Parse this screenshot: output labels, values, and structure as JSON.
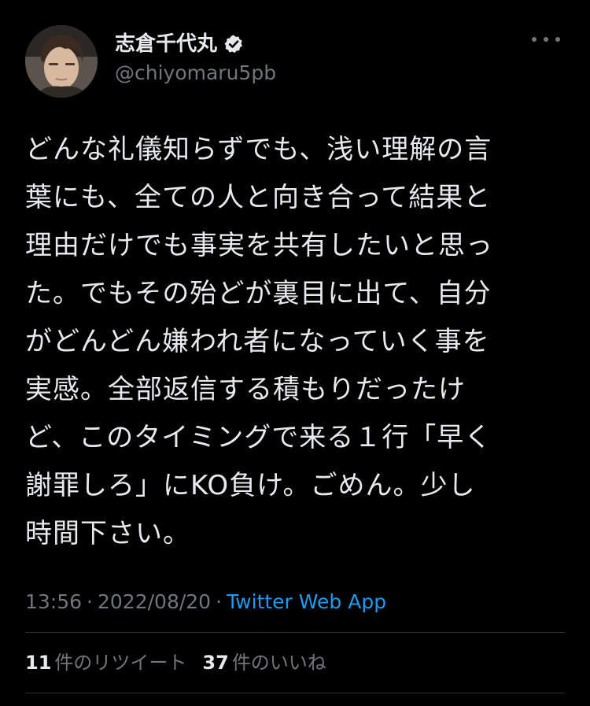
{
  "author": {
    "display_name": "志倉千代丸",
    "handle": "@chiyomaru5pb",
    "avatar_icon": "avatar-photo",
    "verified_icon": "verified-badge-icon",
    "more_icon": "more-options-icon"
  },
  "tweet": {
    "lines": [
      "どんな礼儀知らずでも、浅い理解の言",
      "葉にも、全ての人と向き合って結果と",
      "理由だけでも事実を共有したいと思っ",
      "た。でもその殆どが裏目に出て、自分",
      "がどんどん嫌われ者になっていく事を",
      "実感。全部返信する積もりだったけ",
      "ど、このタイミングで来る１行「早く",
      "謝罪しろ」にKO負け。ごめん。少し",
      "時間下さい。"
    ]
  },
  "meta": {
    "time": "13:56",
    "separator": "·",
    "date": "2022/08/20",
    "source": "Twitter Web App"
  },
  "stats": {
    "retweets_count": "11",
    "retweets_label": "件のリツイート",
    "likes_count": "37",
    "likes_label": "件のいいね"
  },
  "colors": {
    "background": "#000000",
    "text": "#e7e9ea",
    "secondary_text": "#71767b",
    "link": "#1d9bf0",
    "divider": "#2f3336"
  }
}
